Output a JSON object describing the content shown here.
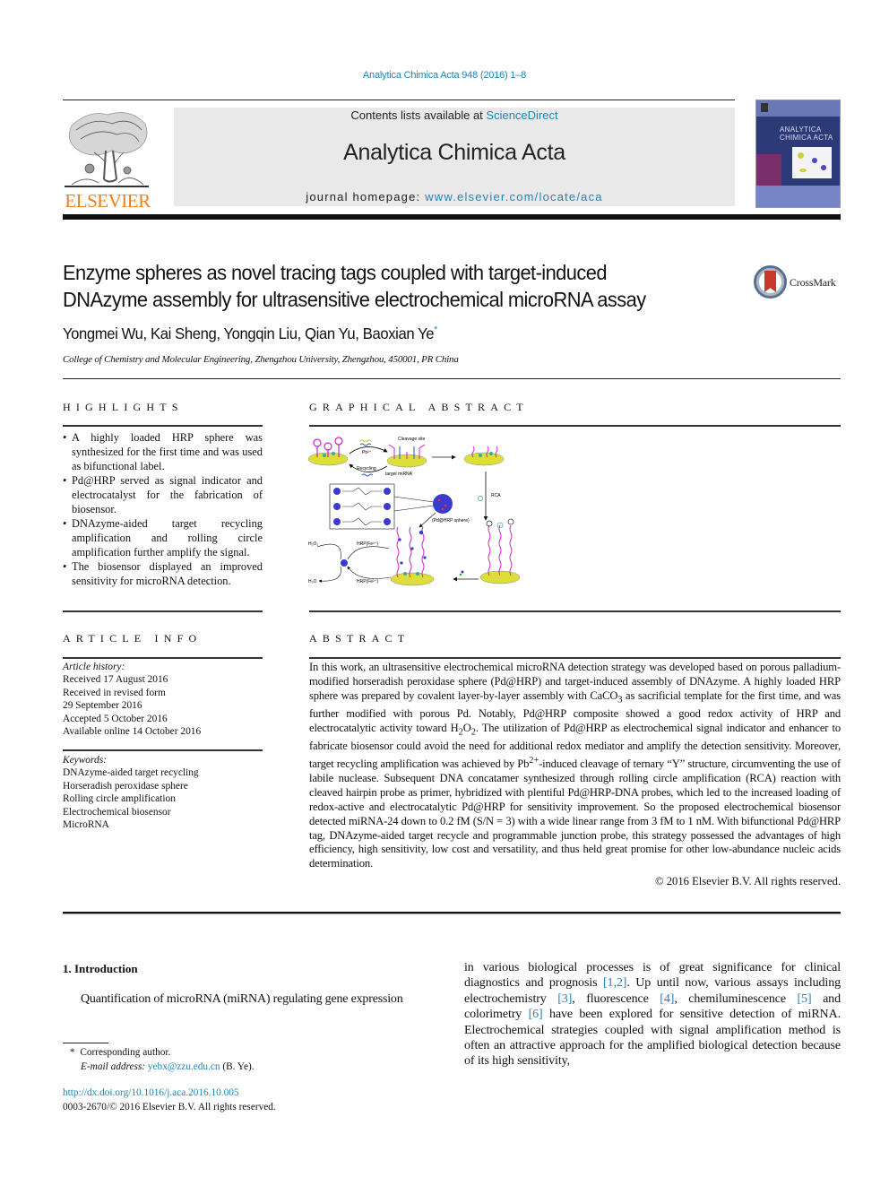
{
  "header": {
    "citation": "Analytica Chimica Acta 948 (2016) 1–8",
    "contents_prefix": "Contents lists available at ",
    "contents_link": "ScienceDirect",
    "journal_name": "Analytica Chimica Acta",
    "homepage_prefix": "journal homepage: ",
    "homepage_link": "www.elsevier.com/locate/aca",
    "publisher_logo": "ELSEVIER",
    "cover_title_line1": "ANALYTICA",
    "cover_title_line2": "CHIMICA ACTA"
  },
  "article": {
    "title_line1": "Enzyme spheres as novel tracing tags coupled with target-induced",
    "title_line2": "DNAzyme assembly for ultrasensitive electrochemical microRNA assay",
    "crossmark_label": "CrossMark",
    "authors": "Yongmei Wu, Kai Sheng, Yongqin Liu, Qian Yu, Baoxian Ye",
    "corresponding_mark": "*",
    "affiliation": "College of Chemistry and Molecular Engineering, Zhengzhou University, Zhengzhou, 450001, PR China"
  },
  "highlights": {
    "heading": "HIGHLIGHTS",
    "items": [
      "A highly loaded HRP sphere was synthesized for the first time and was used as bifunctional label.",
      "Pd@HRP served as signal indicator and electrocatalyst for the fabrication of biosensor.",
      "DNAzyme-aided target recycling amplification and rolling circle amplification further amplify the signal.",
      "The biosensor displayed an improved sensitivity for microRNA detection."
    ]
  },
  "graphical_abstract": {
    "heading": "GRAPHICAL ABSTRACT",
    "labels": {
      "cleavage_site": "Cleavage site",
      "pb": "Pb²⁺",
      "recycling": "Recycling",
      "target": "target miRNA",
      "rca": "RCA",
      "sphere": "(Pd@HRP sphere)",
      "h2o2": "H₂O₂",
      "h2o": "H₂O",
      "hrp_ox": "HRP(Fe³⁺)",
      "hrp_red": "HRP(Fe²⁺)"
    }
  },
  "article_info": {
    "heading": "ARTICLE INFO",
    "history_label": "Article history:",
    "history": [
      "Received 17 August 2016",
      "Received in revised form",
      "29 September 2016",
      "Accepted 5 October 2016",
      "Available online 14 October 2016"
    ],
    "keywords_label": "Keywords:",
    "keywords": [
      "DNAzyme-aided target recycling",
      "Horseradish peroxidase sphere",
      "Rolling circle amplification",
      "Electrochemical biosensor",
      "MicroRNA"
    ]
  },
  "abstract": {
    "heading": "ABSTRACT",
    "p1": "In this work, an ultrasensitive electrochemical microRNA detection strategy was developed based on porous palladium-modified horseradish peroxidase sphere (Pd@HRP) and target-induced assembly of DNAzyme. A highly loaded HRP sphere was prepared by covalent layer-by-layer assembly with CaCO",
    "sub3": "3",
    "p2": " as sacrificial template for the first time, and was further modified with porous Pd. Notably, Pd@HRP composite showed a good redox activity of HRP and electrocatalytic activity toward H",
    "sub2a": "2",
    "o": "O",
    "sub2b": "2",
    "p3": ". The utilization of Pd@HRP as electrochemical signal indicator and enhancer to fabricate biosensor could avoid the need for additional redox mediator and amplify the detection sensitivity. Moreover, target recycling amplification was achieved by Pb",
    "sup": "2+",
    "p4": "-induced cleavage of ternary “Y” structure, circumventing the use of labile nuclease. Subsequent DNA concatamer synthesized through rolling circle amplification (RCA) reaction with cleaved hairpin probe as primer, hybridized with plentiful Pd@HRP-DNA probes, which led to the increased loading of redox-active and electrocatalytic Pd@HRP for sensitivity improvement. So the proposed electrochemical biosensor detected miRNA-24 down to 0.2 fM (S/N = 3) with a wide linear range from 3 fM to 1 nM. With bifunctional Pd@HRP tag, DNAzyme-aided target recycle and programmable junction probe, this strategy possessed the advantages of high efficiency, high sensitivity, low cost and versatility, and thus held great promise for other low-abundance nucleic acids determination.",
    "copyright": "© 2016 Elsevier B.V. All rights reserved."
  },
  "introduction": {
    "heading": "1.  Introduction",
    "left_text": "Quantification of microRNA (miRNA) regulating gene expression",
    "right_parts": [
      {
        "t": "in various biological processes is of great significance for clinical diagnostics and prognosis "
      },
      {
        "ref": "[1,2]"
      },
      {
        "t": ". Up until now, various assays including electrochemistry "
      },
      {
        "ref": "[3]"
      },
      {
        "t": ", fluorescence "
      },
      {
        "ref": "[4]"
      },
      {
        "t": ", chemiluminescence "
      },
      {
        "ref": "[5]"
      },
      {
        "t": " and colorimetry "
      },
      {
        "ref": "[6]"
      },
      {
        "t": " have been explored for sensitive detection of miRNA. Electrochemical strategies coupled with signal amplification method is often an attractive approach for the amplified biological detection because of its high sensitivity,"
      }
    ]
  },
  "footnote": {
    "mark": "*",
    "corresponding": "Corresponding author.",
    "email_label": "E-mail address: ",
    "email": "yebx@zzu.edu.cn",
    "email_suffix": " (B. Ye).",
    "doi": "http://dx.doi.org/10.1016/j.aca.2016.10.005",
    "issn": "0003-2670/© 2016 Elsevier B.V. All rights reserved."
  },
  "colors": {
    "link": "#1f86b8",
    "elsevier_orange": "#f07e1a",
    "banner_bg": "#e9e9e9"
  }
}
